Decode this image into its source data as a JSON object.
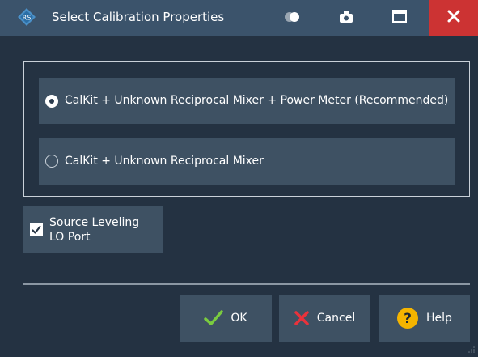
{
  "window": {
    "title": "Select Calibration Properties",
    "icons": [
      "rs-logo-icon",
      "toggle-icon",
      "camera-icon",
      "maximize-icon",
      "close-icon"
    ]
  },
  "options": [
    {
      "label": "CalKit + Unknown Reciprocal Mixer + Power Meter (Recommended)",
      "selected": true
    },
    {
      "label": "CalKit + Unknown Reciprocal Mixer",
      "selected": false
    }
  ],
  "checkbox": {
    "label": "Source Leveling LO Port",
    "checked": true
  },
  "buttons": {
    "ok": "OK",
    "cancel": "Cancel",
    "help": "Help"
  },
  "colors": {
    "background": "#243242",
    "titlebar": "#3b536b",
    "close": "#cc3333",
    "control": "#3e5163",
    "ok_check": "#7acb3f",
    "cancel_x": "#e8323b",
    "help": "#f4b400"
  }
}
